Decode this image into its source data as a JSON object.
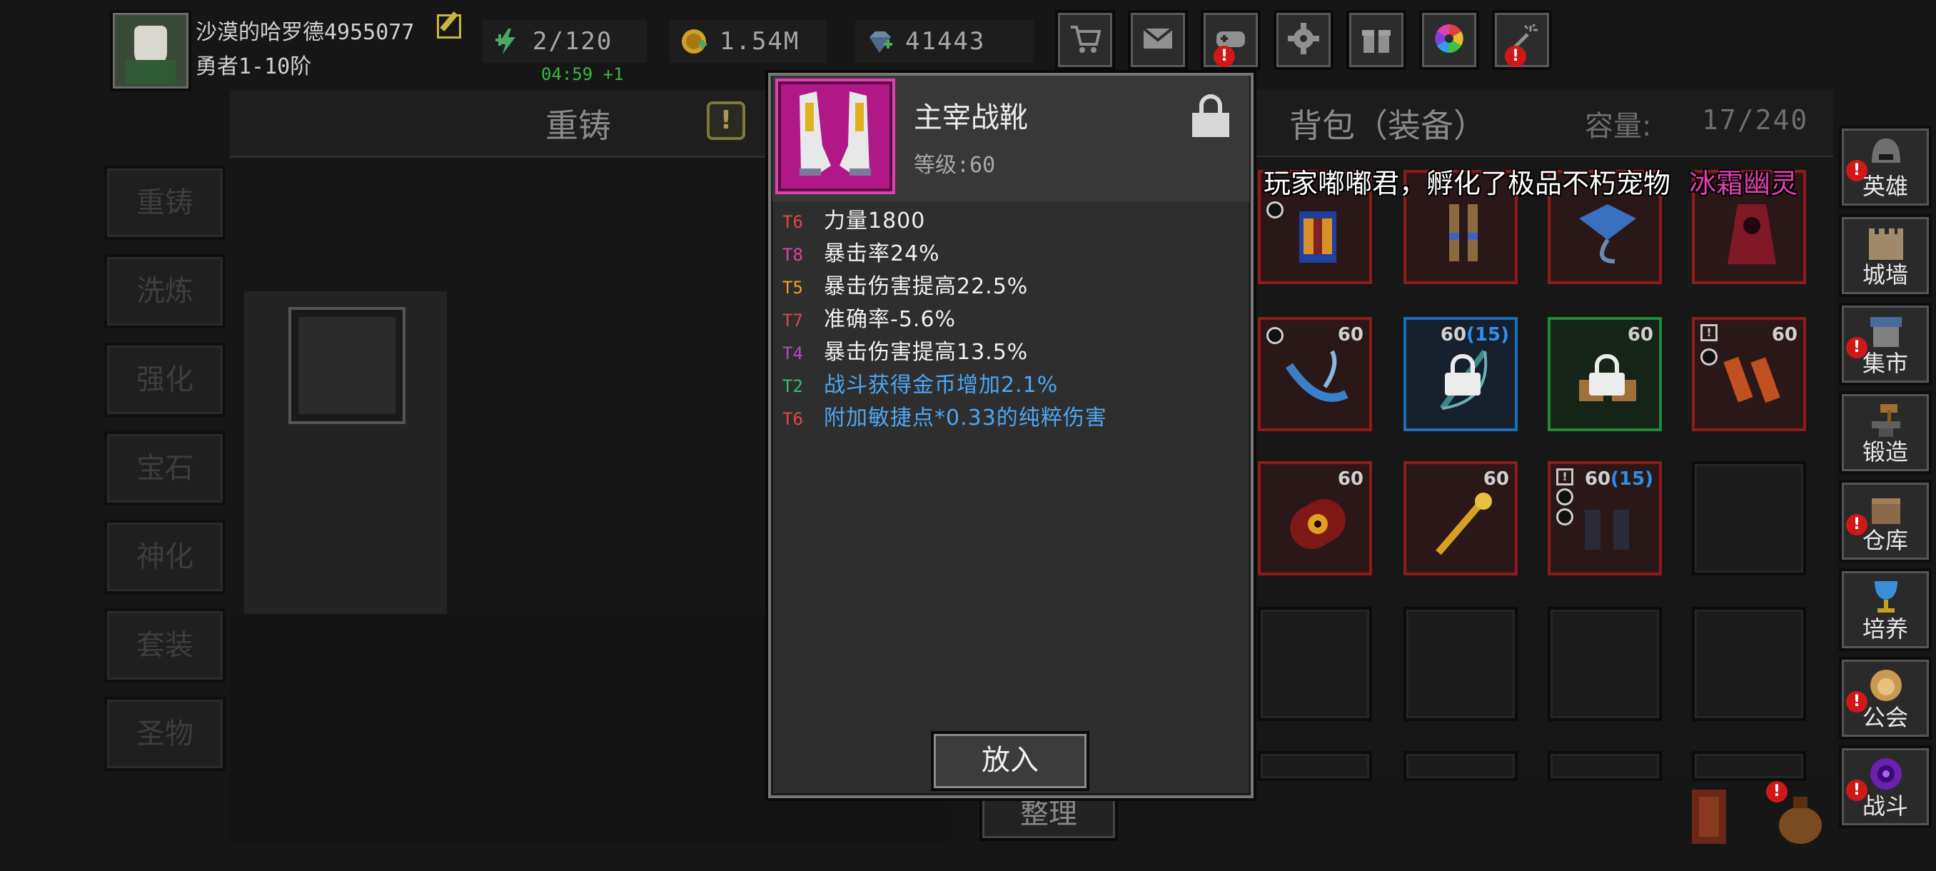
{
  "player": {
    "name": "沙漠的哈罗德4955077",
    "rank": "勇者1-10阶"
  },
  "resources": {
    "energy": "2/120",
    "energy_timer": "04:59 +1",
    "gold": "1.54M",
    "gems": "41443"
  },
  "top_buttons": [
    "shop-cart-icon",
    "mail-icon",
    "gamepad-icon",
    "settings-gear-icon",
    "gift-icon",
    "color-wheel-icon",
    "fireworks-icon"
  ],
  "left_panel": {
    "title": "重铸",
    "help_icon": "!",
    "tabs": [
      "重铸",
      "洗炼",
      "强化",
      "宝石",
      "神化",
      "套装",
      "圣物"
    ]
  },
  "inventory": {
    "title": "背包（装备）",
    "capacity_label": "容量:",
    "capacity_value": "17/240",
    "sort_label": "整理",
    "items": [
      {
        "level": "60",
        "extra": ""
      },
      {
        "level": "60",
        "extra": ""
      },
      {
        "level": "60",
        "extra": "(15)"
      },
      {
        "level": "60",
        "extra": ""
      },
      {
        "level": "60",
        "extra": ""
      },
      {
        "level": "60",
        "extra": ""
      },
      {
        "level": "60",
        "extra": "(15)"
      }
    ]
  },
  "right_nav": [
    "英雄",
    "城墙",
    "集市",
    "锻造",
    "仓库",
    "培养",
    "公会",
    "战斗"
  ],
  "broadcast": {
    "text": "恭喜！玩家嘟嘟君，孵化了极品不朽宠物",
    "pet": "冰霜幽灵"
  },
  "tooltip": {
    "name": "主宰战靴",
    "level": "等级:60",
    "stats": [
      {
        "tier": "T6",
        "tier_color": "#e04848",
        "text": "力量1800",
        "blue": false
      },
      {
        "tier": "T8",
        "tier_color": "#e040b0",
        "text": "暴击率24%",
        "blue": false
      },
      {
        "tier": "T5",
        "tier_color": "#f0a020",
        "text": "暴击伤害提高22.5%",
        "blue": false
      },
      {
        "tier": "T7",
        "tier_color": "#e04848",
        "text": "准确率-5.6%",
        "blue": false
      },
      {
        "tier": "T4",
        "tier_color": "#c040d0",
        "text": "暴击伤害提高13.5%",
        "blue": false
      },
      {
        "tier": "T2",
        "tier_color": "#30c070",
        "text": "战斗获得金币增加2.1%",
        "blue": true
      },
      {
        "tier": "T6",
        "tier_color": "#e04848",
        "text": "附加敏捷点*0.33的纯粹伤害",
        "blue": true
      }
    ],
    "put_button": "放入"
  }
}
